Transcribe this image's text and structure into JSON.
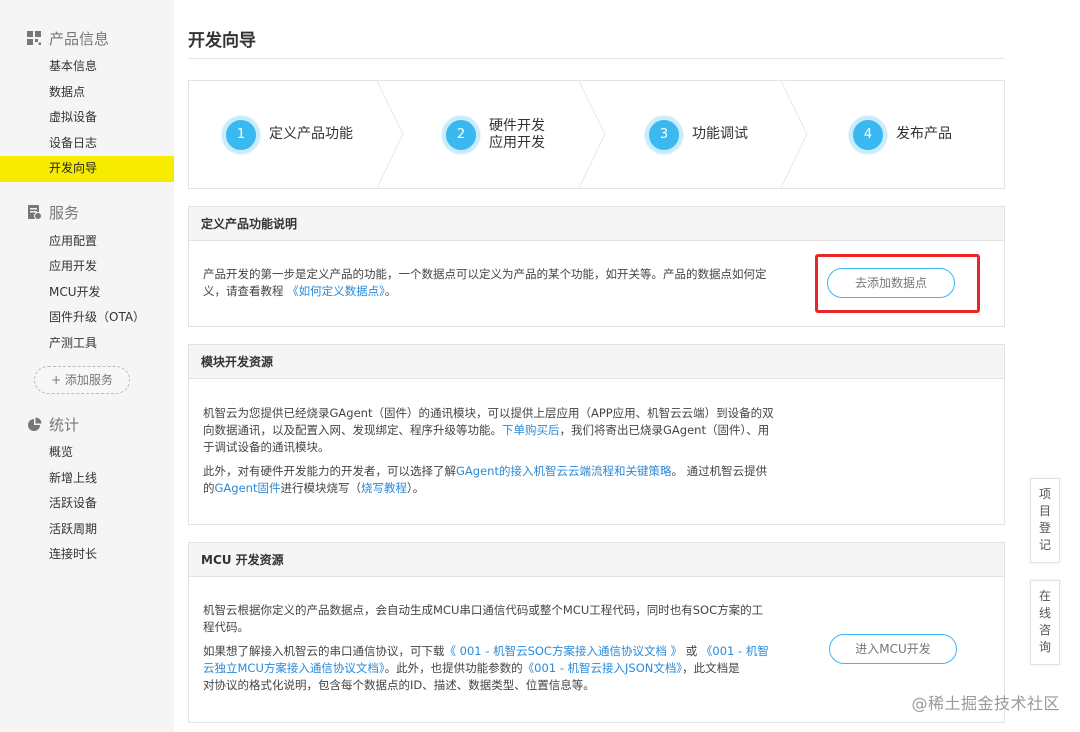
{
  "sidebar": {
    "groups": [
      {
        "title": "产品信息",
        "icon": "grid-icon",
        "items": [
          "基本信息",
          "数据点",
          "虚拟设备",
          "设备日志",
          "开发向导"
        ]
      },
      {
        "title": "服务",
        "icon": "document-icon",
        "items": [
          "应用配置",
          "应用开发",
          "MCU开发",
          "固件升级（OTA）",
          "产测工具"
        ]
      },
      {
        "title": "统计",
        "icon": "pie-chart-icon",
        "items": [
          "概览",
          "新增上线",
          "活跃设备",
          "活跃周期",
          "连接时长"
        ]
      }
    ],
    "active_item": "开发向导",
    "add_service": "+ 添加服务"
  },
  "page": {
    "title": "开发向导"
  },
  "steps": [
    {
      "num": "1",
      "label": "定义产品功能"
    },
    {
      "num": "2",
      "label_line1": "硬件开发",
      "label_line2": "应用开发"
    },
    {
      "num": "3",
      "label": "功能调试"
    },
    {
      "num": "4",
      "label": "发布产品"
    }
  ],
  "panel1": {
    "title": "定义产品功能说明",
    "text1": "产品开发的第一步是定义产品的功能，一个数据点可以定义为产品的某个功能，如开关等。产品的数据点如何定",
    "text2": "义，请查看教程",
    "link": "《如何定义数据点》",
    "text3": "。",
    "button": "去添加数据点"
  },
  "panel2": {
    "title": "模块开发资源",
    "p1_line1": "机智云为您提供已经烧录GAgent（固件）的通讯模块，可以提供上层应用（APP应用、机智云云端）到设备的双",
    "p1_line2a": "向数据通讯，以及配置入网、发现绑定、程序升级等功能。",
    "p1_link": "下单购买后",
    "p1_line2b": "，我们将寄出已烧录GAgent（固件）、用",
    "p1_line3": "于调试设备的通讯模块。",
    "p2_a": "此外，对有硬件开发能力的开发者，可以选择了解",
    "p2_link1": "GAgent的接入机智云云端流程和关键策略",
    "p2_b": "。 通过机智云提供",
    "p2_c": "的",
    "p2_link2": "GAgent固件",
    "p2_d": "进行模块烧写（",
    "p2_link3": "烧写教程",
    "p2_e": "）。"
  },
  "panel3": {
    "title": "MCU 开发资源",
    "p1_line1": "机智云根据你定义的产品数据点，会自动生成MCU串口通信代码或整个MCU工程代码，同时也有SOC方案的工",
    "p1_line2": "程代码。",
    "p2_a": "如果想了解接入机智云的串口通信协议，可下载",
    "p2_link1": "《 001 - 机智云SOC方案接入通信协议文档 》",
    "p2_b": " 或 ",
    "p2_link2a": "《001 - 机智",
    "p2_link2b": "云独立MCU方案接入通信协议文档》",
    "p2_c": "。此外，也提供功能参数的",
    "p2_link3": "《001 - 机智云接入JSON文档》",
    "p2_d": "，此文档是",
    "p2_e": "对协议的格式化说明，包含每个数据点的ID、描述、数据类型、位置信息等。",
    "button": "进入MCU开发"
  },
  "float_tabs": [
    {
      "chars": [
        "项",
        "目",
        "登",
        "记"
      ]
    },
    {
      "chars": [
        "在",
        "线",
        "咨",
        "询"
      ]
    }
  ],
  "watermark": "@稀土掘金技术社区",
  "colors": {
    "accent": "#3ab8f0",
    "active_bg": "#f7ec00",
    "highlight": "#e8262a",
    "link": "#2a8ad8"
  }
}
